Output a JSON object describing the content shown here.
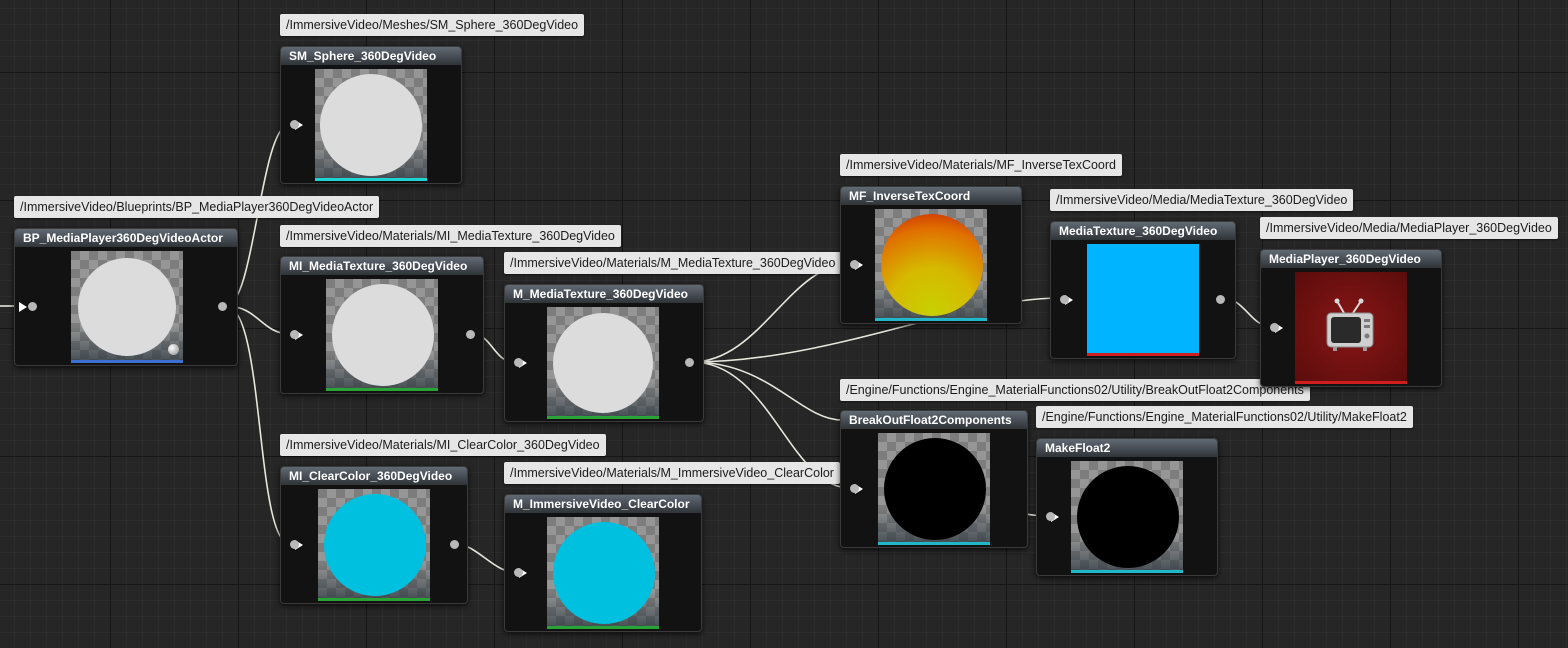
{
  "graph": {
    "edges_color": "#e6e6dc",
    "nodes": [
      {
        "id": "bp",
        "title": "BP_MediaPlayer360DegVideoActor",
        "path": "/ImmersiveVideo/Blueprints/BP_MediaPlayer360DegVideoActor",
        "preview": "light-sphere",
        "accent": "#3b6fd1"
      },
      {
        "id": "sm",
        "title": "SM_Sphere_360DegVideo",
        "path": "/ImmersiveVideo/Meshes/SM_Sphere_360DegVideo",
        "preview": "light-sphere",
        "accent": "#1fd3d3"
      },
      {
        "id": "mi_mt",
        "title": "MI_MediaTexture_360DegVideo",
        "path": "/ImmersiveVideo/Materials/MI_MediaTexture_360DegVideo",
        "preview": "light-sphere",
        "accent": "#2aa337"
      },
      {
        "id": "m_mt",
        "title": "M_MediaTexture_360DegVideo",
        "path": "/ImmersiveVideo/Materials/M_MediaTexture_360DegVideo",
        "preview": "light-sphere",
        "accent": "#2aa337"
      },
      {
        "id": "mi_cc",
        "title": "MI_ClearColor_360DegVideo",
        "path": "/ImmersiveVideo/Materials/MI_ClearColor_360DegVideo",
        "preview": "cyan-sphere",
        "accent": "#2aa337"
      },
      {
        "id": "m_cc",
        "title": "M_ImmersiveVideo_ClearColor",
        "path": "/ImmersiveVideo/Materials/M_ImmersiveVideo_ClearColor",
        "preview": "cyan-sphere",
        "accent": "#2aa337"
      },
      {
        "id": "mf",
        "title": "MF_InverseTexCoord",
        "path": "/ImmersiveVideo/Materials/MF_InverseTexCoord",
        "preview": "gradient-sphere",
        "accent": "#1fb8c8"
      },
      {
        "id": "mtex",
        "title": "MediaTexture_360DegVideo",
        "path": "/ImmersiveVideo/Media/MediaTexture_360DegVideo",
        "preview": "blue-square",
        "accent": "#d01e1e"
      },
      {
        "id": "mplayer",
        "title": "MediaPlayer_360DegVideo",
        "path": "/ImmersiveVideo/Media/MediaPlayer_360DegVideo",
        "preview": "tv-icon",
        "accent": "#d01e1e"
      },
      {
        "id": "bof",
        "title": "BreakOutFloat2Components",
        "path": "/Engine/Functions/Engine_MaterialFunctions02/Utility/BreakOutFloat2Components",
        "preview": "black-sphere",
        "accent": "#1fb8c8"
      },
      {
        "id": "mkf",
        "title": "MakeFloat2",
        "path": "/Engine/Functions/Engine_MaterialFunctions02/Utility/MakeFloat2",
        "preview": "black-sphere",
        "accent": "#1fb8c8"
      }
    ]
  },
  "colors": {
    "light_sphere": "#dcdcdc",
    "cyan_sphere": "#00c0e0",
    "blue_square": "#00b4ff",
    "black_sphere": "#000000",
    "player_bg": "#7a1212"
  }
}
